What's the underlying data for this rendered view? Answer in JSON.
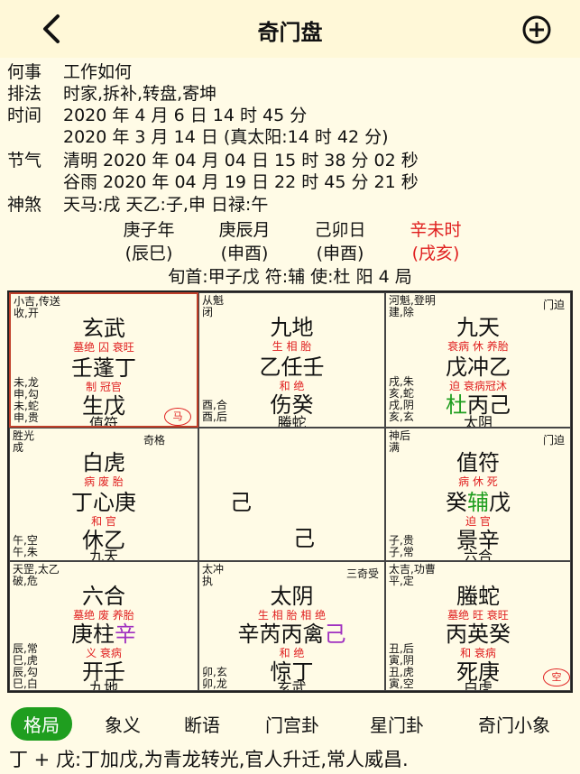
{
  "header": {
    "title": "奇门盘",
    "back_icon": "chevron-left-icon",
    "add_icon": "plus-circle-icon"
  },
  "info": {
    "matter_label": "何事",
    "matter": "工作如何",
    "method_label": "排法",
    "method": "时家,拆补,转盘,寄坤",
    "time_label": "时间",
    "time1": "2020 年 4 月 6 日 14 时 45 分",
    "time2": "2020 年 3 月 14 日 (真太阳:14 时 42 分)",
    "term_label": "节气",
    "term1": "清明 2020 年 04 月 04 日 15 时 38 分 02 秒",
    "term2": "谷雨 2020 年 04 月 19 日 22 时 45 分 21 秒",
    "shensha_label": "神煞",
    "shensha": "天马:戌 天乙:子,申 日禄:午"
  },
  "pillars": [
    {
      "top": "庚子年",
      "bottom": "(辰巳)",
      "color": "#111111"
    },
    {
      "top": "庚辰月",
      "bottom": "(申酉)",
      "color": "#111111"
    },
    {
      "top": "己卯日",
      "bottom": "(申酉)",
      "color": "#111111"
    },
    {
      "top": "辛未时",
      "bottom": "(戌亥)",
      "color": "#e02020"
    }
  ],
  "xunshou": "旬首:甲子戊 符:辅 使:杜 阳 4 局",
  "palaces": {
    "p1": {
      "tl1": "小吉,传送",
      "tl2": "收,开",
      "god": "玄武",
      "s1": "墓绝  囚  衰旺",
      "mid": "壬蓬丁",
      "s2": "制  冠官",
      "low": "生戊",
      "b1": "未,龙",
      "b2": "申,勾",
      "b3": "未,蛇",
      "b4": "申,贵",
      "bottom": "值符",
      "mark": "马"
    },
    "p2": {
      "tl1": "从魁",
      "tl2": "闭",
      "god": "九地",
      "s1": "生  相  胎",
      "mid": "乙任壬",
      "s2": "和  绝",
      "low": "伤癸",
      "b1": "酉,合",
      "b2": "酉,后",
      "bottom": "螣蛇"
    },
    "p3": {
      "tl1": "河魁,登明",
      "tl2": "建,除",
      "tr": "门迫",
      "god": "九天",
      "s1": "衰病  休  养胎",
      "mid": "戊冲乙",
      "s2": "迫  衰病冠沐",
      "low_a": "杜",
      "low_b": "丙己",
      "b1": "戌,朱",
      "b2": "亥,蛇",
      "b3": "戌,阴",
      "b4": "亥,玄",
      "bottom": "太阴"
    },
    "p4": {
      "tl1": "胜光",
      "tl2": "成",
      "tr": "奇格",
      "god": "白虎",
      "s1": "病  废  胎",
      "mid": "丁心庚",
      "s2": "和  官",
      "low": "休乙",
      "b1": "午,空",
      "b2": "午,朱",
      "bottom": "九天"
    },
    "p5": {
      "g1": "己",
      "g2": "己"
    },
    "p6": {
      "tl1": "神后",
      "tl2": "满",
      "tr": "门迫",
      "god": "值符",
      "s1": "病  休  死",
      "mid_a": "癸",
      "mid_b": "辅",
      "mid_c": "戊",
      "s2": "迫  官",
      "low": "景辛",
      "b1": "子,贵",
      "b2": "子,常",
      "bottom": "六合"
    },
    "p7": {
      "tl1": "天罡,太乙",
      "tl2": "破,危",
      "god": "六合",
      "s1": "墓绝  废  养胎",
      "mid_a": "庚柱",
      "mid_b": "辛",
      "s2": "义  衰病",
      "low": "开壬",
      "b1": "辰,常",
      "b2": "巳,虎",
      "b3": "辰,勾",
      "b4": "巳,白",
      "bottom": "九地"
    },
    "p8": {
      "tl1": "太冲",
      "tl2": "执",
      "tr": "三奇受",
      "god": "太阴",
      "s1": "生  相  胎  相  绝",
      "mid_a": "辛芮丙禽",
      "mid_b": "己",
      "s2": "和  绝",
      "low": "惊丁",
      "b1": "卯,玄",
      "b2": "卯,龙",
      "bottom": "玄武"
    },
    "p9": {
      "tl1": "太吉,功曹",
      "tl2": "平,定",
      "god": "螣蛇",
      "s1": "墓绝  旺  衰旺",
      "mid": "丙英癸",
      "s2": "和  衰病",
      "low": "死庚",
      "b1": "丑,后",
      "b2": "寅,阴",
      "b3": "丑,虎",
      "b4": "寅,空",
      "bottom": "白虎",
      "mark": "空"
    }
  },
  "tabs": [
    "格局",
    "象义",
    "断语",
    "门宫卦",
    "星门卦",
    "奇门小象"
  ],
  "description": "丁 + 戊:丁加戊,为青龙转光,官人升迁,常人威昌."
}
